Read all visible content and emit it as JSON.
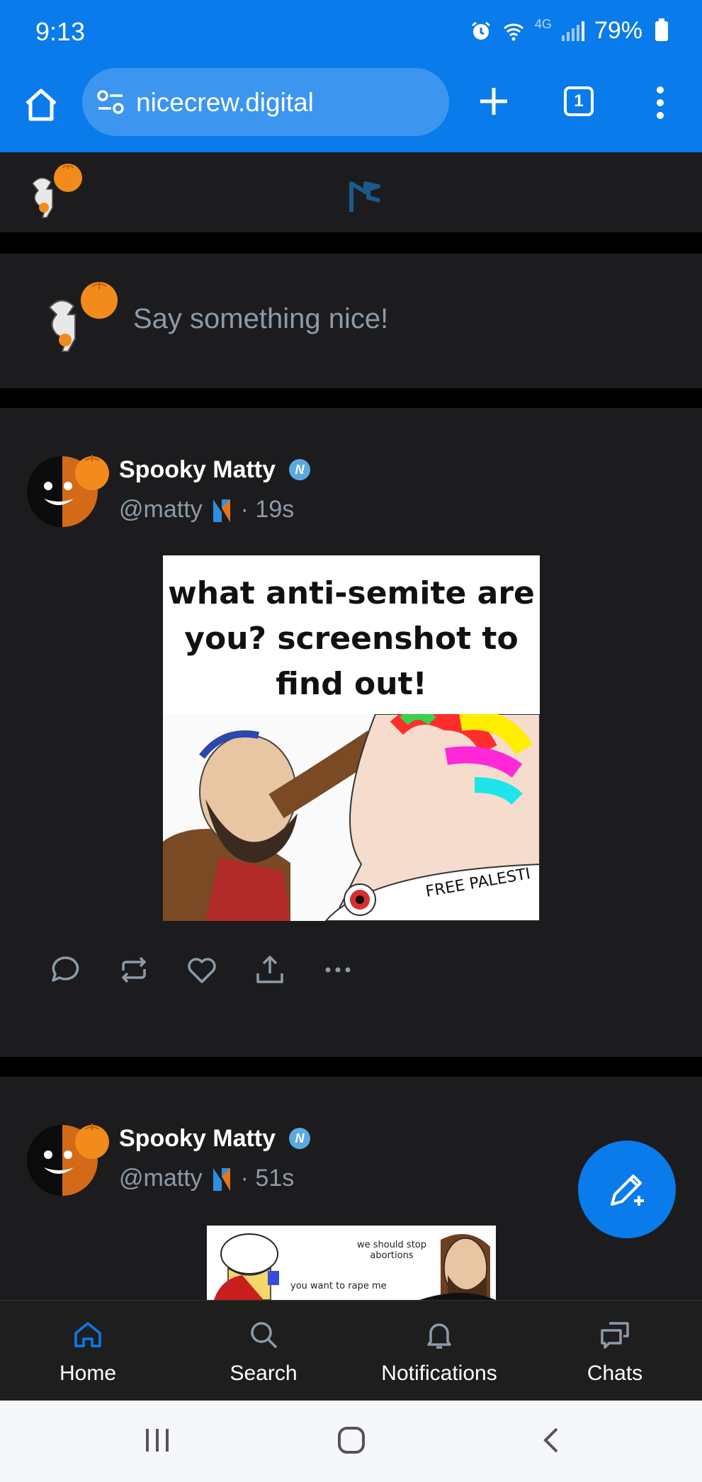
{
  "status_bar": {
    "time": "9:13",
    "network": "4G",
    "battery": "79%"
  },
  "browser": {
    "url": "nicecrew.digital",
    "tab_count": "1"
  },
  "compose": {
    "placeholder": "Say something nice!"
  },
  "posts": [
    {
      "author": "Spooky Matty",
      "verified_mark": "N",
      "handle": "@matty",
      "time": "· 19s",
      "image_text": "what anti-semite are you? screenshot to find out!",
      "image_caption": "FREE PALESTI"
    },
    {
      "author": "Spooky Matty",
      "verified_mark": "N",
      "handle": "@matty",
      "time": "· 51s",
      "image_text_right": "we should stop abortions",
      "image_text_left": "you want to rape me"
    }
  ],
  "bottom_nav": [
    {
      "label": "Home",
      "icon": "home-icon",
      "active": true
    },
    {
      "label": "Search",
      "icon": "search-icon"
    },
    {
      "label": "Notifications",
      "icon": "bell-icon"
    },
    {
      "label": "Chats",
      "icon": "chats-icon"
    }
  ],
  "colors": {
    "brand": "#0a7bea",
    "card": "#1c1c1e",
    "muted": "#8d9ba8",
    "active": "#0a7bea"
  }
}
